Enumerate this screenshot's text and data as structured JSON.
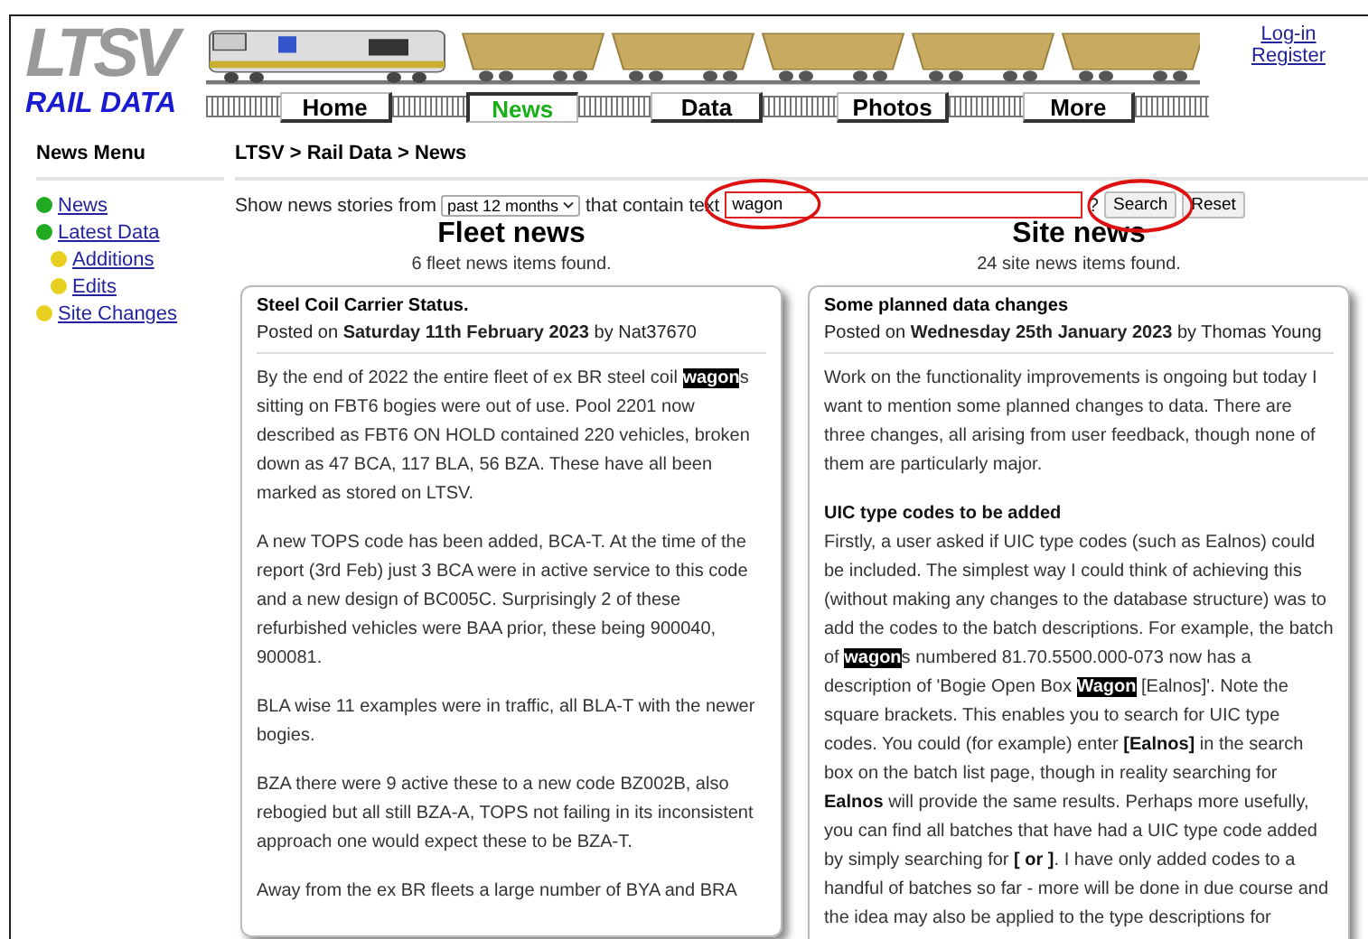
{
  "logo": {
    "mark": "LTSV",
    "subtitle": "RAIL DATA"
  },
  "nav": [
    {
      "label": "Home",
      "selected": false
    },
    {
      "label": "News",
      "selected": true
    },
    {
      "label": "Data",
      "selected": false
    },
    {
      "label": "Photos",
      "selected": false
    },
    {
      "label": "More",
      "selected": false
    }
  ],
  "account_links": [
    "Log-in",
    "Register"
  ],
  "sidebar": {
    "title": "News Menu",
    "items": [
      {
        "label": "News",
        "color": "#22aa22"
      },
      {
        "label": "Latest Data",
        "color": "#22aa22",
        "children": [
          {
            "label": "Additions",
            "color": "#e8d020"
          },
          {
            "label": "Edits",
            "color": "#e8d020"
          }
        ]
      },
      {
        "label": "Site Changes",
        "color": "#e8d020"
      }
    ]
  },
  "breadcrumb": "LTSV > Rail Data > News",
  "filter": {
    "prefix": "Show news stories from",
    "period": "past 12 months",
    "middle": "that contain text",
    "search_value": "wagon",
    "search_circled": true,
    "help": "?",
    "search_button": "Search",
    "search_button_circled": true,
    "reset_button": "Reset"
  },
  "columns": [
    {
      "title": "Fleet news",
      "count": "6 fleet news items found.",
      "card": {
        "headline": "Steel Coil Carrier Status.",
        "posted_prefix": "Posted on",
        "date": "Saturday 11th February 2023",
        "posted_by": "by Nat37670",
        "paragraphs": [
          {
            "kind": "paragraph",
            "segments": [
              {
                "kind": "text",
                "text": "By the end of 2022 the entire fleet of ex BR steel coil "
              },
              {
                "kind": "highlight",
                "text": "wagon"
              },
              {
                "kind": "text",
                "text": "s sitting on FBT6 bogies were out of use. Pool 2201 now described as FBT6 ON HOLD contained 220 vehicles, broken down as 47 BCA, 117 BLA, 56 BZA. These have all been marked as stored on LTSV."
              }
            ]
          },
          {
            "kind": "paragraph",
            "segments": [
              {
                "kind": "text",
                "text": "A new TOPS code has been added, BCA-T. At the time of the report (3rd Feb) just 3 BCA were in active service to this code and a new design of BC005C. Surprisingly 2 of these refurbished vehicles were BAA prior, these being 900040, 900081."
              }
            ]
          },
          {
            "kind": "paragraph",
            "segments": [
              {
                "kind": "text",
                "text": "BLA wise 11 examples were in traffic, all BLA-T with the newer bogies."
              }
            ]
          },
          {
            "kind": "paragraph",
            "segments": [
              {
                "kind": "text",
                "text": "BZA there were 9 active these to a new code BZ002B, also rebogied but all still BZA-A, TOPS not failing in its inconsistent approach one would expect these to be BZA-T."
              }
            ]
          },
          {
            "kind": "paragraph",
            "segments": [
              {
                "kind": "text",
                "text": "Away from the ex BR fleets a large number of BYA and BRA"
              }
            ]
          }
        ]
      }
    },
    {
      "title": "Site news",
      "count": "24 site news items found.",
      "card": {
        "headline": "Some planned data changes",
        "posted_prefix": "Posted on",
        "date": "Wednesday 25th January 2023",
        "posted_by": "by Thomas Young",
        "paragraphs": [
          {
            "kind": "paragraph",
            "segments": [
              {
                "kind": "text",
                "text": "Work on the functionality improvements is ongoing but today I want to mention some planned changes to data. There are three changes, all arising from user feedback, though none of them are particularly major."
              }
            ]
          },
          {
            "kind": "subheading",
            "segments": [
              {
                "kind": "text",
                "text": "UIC type codes to be added"
              }
            ]
          },
          {
            "kind": "continuation",
            "segments": [
              {
                "kind": "text",
                "text": "Firstly, a user asked if UIC type codes (such as Ealnos) could be included. The simplest way I could think of achieving this (without making any changes to the database structure) was to add the codes to the batch descriptions. For example, the batch of "
              },
              {
                "kind": "highlight",
                "text": "wagon"
              },
              {
                "kind": "text",
                "text": "s numbered 81.70.5500.000-073 now has a description of 'Bogie Open Box "
              },
              {
                "kind": "highlight",
                "text": "Wagon"
              },
              {
                "kind": "text",
                "text": " [Ealnos]'. Note the square brackets. This enables you to search for UIC type codes. You could (for example) enter "
              },
              {
                "kind": "bold",
                "text": "[Ealnos]"
              },
              {
                "kind": "text",
                "text": " in the search box on the batch list page, though in reality searching for "
              },
              {
                "kind": "bold",
                "text": "Ealnos"
              },
              {
                "kind": "text",
                "text": " will provide the same results. Perhaps more usefully, you can find all batches that have had a UIC type code added by simply searching for "
              },
              {
                "kind": "bold",
                "text": "[ or ]"
              },
              {
                "kind": "text",
                "text": ". I have only added codes to a handful of batches so far - more will be done in due course and the idea may also be applied to the type descriptions for"
              }
            ]
          }
        ]
      }
    }
  ]
}
